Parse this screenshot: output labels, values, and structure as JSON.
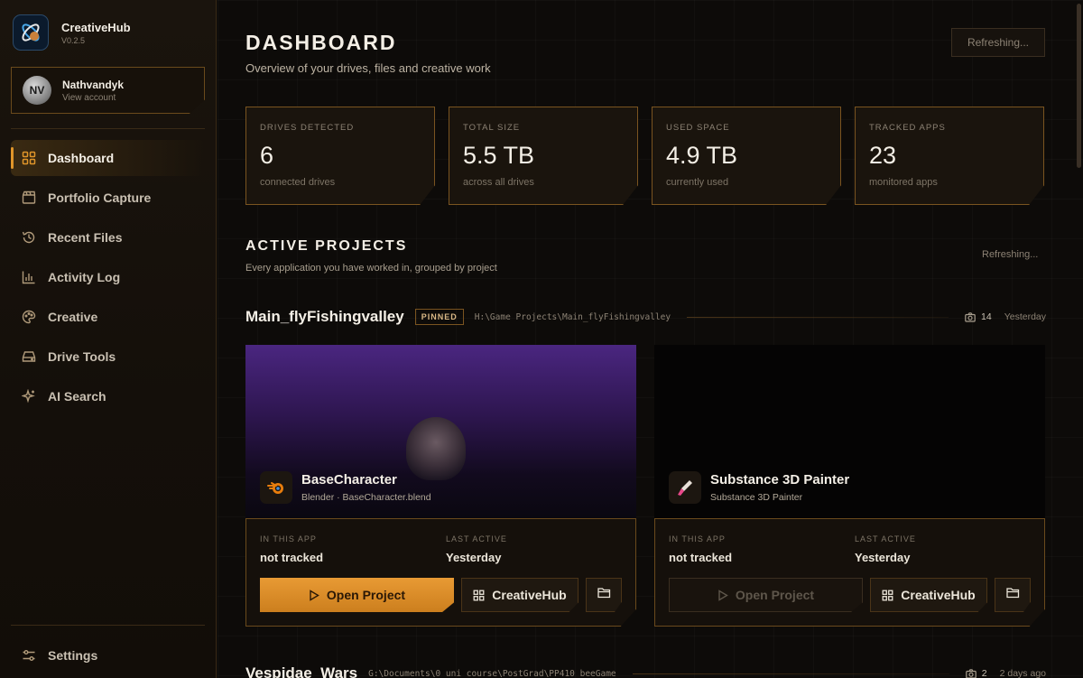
{
  "app": {
    "name": "CreativeHub",
    "version": "V0.2.5"
  },
  "user": {
    "name": "Nathvandyk",
    "sub": "View account",
    "initials": "NV"
  },
  "nav": {
    "items": [
      {
        "label": "Dashboard",
        "icon": "grid-icon"
      },
      {
        "label": "Portfolio Capture",
        "icon": "clapper-icon"
      },
      {
        "label": "Recent Files",
        "icon": "history-icon"
      },
      {
        "label": "Activity Log",
        "icon": "bar-chart-icon"
      },
      {
        "label": "Creative",
        "icon": "palette-icon"
      },
      {
        "label": "Drive Tools",
        "icon": "drive-icon"
      },
      {
        "label": "AI Search",
        "icon": "sparkle-icon"
      }
    ],
    "settings_label": "Settings"
  },
  "header": {
    "title": "DASHBOARD",
    "subtitle": "Overview of your drives, files and creative work",
    "refresh_label": "Refreshing..."
  },
  "stats": [
    {
      "label": "DRIVES DETECTED",
      "value": "6",
      "sub": "connected drives"
    },
    {
      "label": "TOTAL SIZE",
      "value": "5.5 TB",
      "sub": "across all drives"
    },
    {
      "label": "USED SPACE",
      "value": "4.9 TB",
      "sub": "currently used"
    },
    {
      "label": "TRACKED APPS",
      "value": "23",
      "sub": "monitored apps"
    }
  ],
  "projects_section": {
    "title": "ACTIVE PROJECTS",
    "subtitle": "Every application you have worked in, grouped by project",
    "refresh_label": "Refreshing..."
  },
  "project1": {
    "name": "Main_flyFishingvalley",
    "badge": "PINNED",
    "path": "H:\\Game Projects\\Main_flyFishingvalley",
    "count": "14",
    "when": "Yesterday",
    "cards": [
      {
        "app_name": "BaseCharacter",
        "app_sub": "Blender · BaseCharacter.blend",
        "icon": "blender-icon",
        "in_app_label": "IN THIS APP",
        "in_app_value": "not tracked",
        "last_label": "LAST ACTIVE",
        "last_value": "Yesterday",
        "open_label": "Open Project",
        "hub_label": "CreativeHub"
      },
      {
        "app_name": "Substance 3D Painter",
        "app_sub": "Substance 3D Painter",
        "icon": "brush-icon",
        "in_app_label": "IN THIS APP",
        "in_app_value": "not tracked",
        "last_label": "LAST ACTIVE",
        "last_value": "Yesterday",
        "open_label": "Open Project",
        "hub_label": "CreativeHub"
      }
    ]
  },
  "project2": {
    "name": "Vespidae_Wars",
    "path": "G:\\Documents\\0 uni course\\PostGrad\\PP410 beeGame",
    "count": "2",
    "when": "2 days ago"
  },
  "colors": {
    "accent": "#e0952a",
    "border": "#7a5420",
    "bg": "#0d0b09"
  }
}
